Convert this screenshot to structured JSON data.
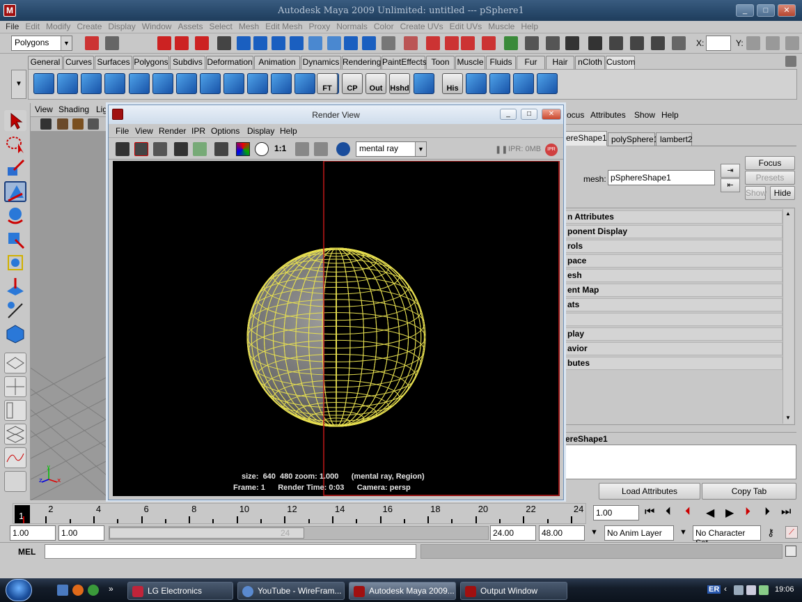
{
  "window": {
    "title": "Autodesk Maya 2009 Unlimited: untitled   ---   pSphere1"
  },
  "menubar": [
    "File",
    "Edit",
    "Modify",
    "Create",
    "Display",
    "Window",
    "Assets",
    "Select",
    "Mesh",
    "Edit Mesh",
    "Proxy",
    "Normals",
    "Color",
    "Create UVs",
    "Edit UVs",
    "Muscle",
    "Help"
  ],
  "statusline": {
    "mode": "Polygons",
    "x_label": "X:",
    "y_label": "Y:"
  },
  "shelf": {
    "tabs": [
      "General",
      "Curves",
      "Surfaces",
      "Polygons",
      "Subdivs",
      "Deformation",
      "Animation",
      "Dynamics",
      "Rendering",
      "PaintEffects",
      "Toon",
      "Muscle",
      "Fluids",
      "Fur",
      "Hair",
      "nCloth",
      "Custom"
    ],
    "active_tab": "Custom",
    "text_icons": [
      "FT",
      "CP",
      "Out",
      "Hshd",
      "His"
    ]
  },
  "viewport": {
    "menu": [
      "View",
      "Shading",
      "Lig"
    ]
  },
  "render_view": {
    "title": "Render View",
    "menu": [
      "File",
      "View",
      "Render",
      "IPR",
      "Options",
      "Display",
      "Help"
    ],
    "ratio": "1:1",
    "renderer": "mental ray",
    "ipr_status": "IPR: 0MB",
    "ipr_badge": "IPR",
    "caption_line1": "size:  640  480 zoom: 1.000      (mental ray, Region)",
    "caption_line2": "Frame: 1      Render Time: 0:03      Camera: persp"
  },
  "attribute_editor": {
    "menu": [
      "ocus",
      "Attributes",
      "Show",
      "Help"
    ],
    "tabs": [
      "ereShape1",
      "polySphere1",
      "lambert2"
    ],
    "mesh_label": "mesh:",
    "mesh_value": "pSphereShape1",
    "buttons": {
      "focus": "Focus",
      "presets": "Presets",
      "show": "Show",
      "hide": "Hide"
    },
    "sections": [
      "n Attributes",
      "ponent Display",
      "rols",
      "pace",
      "esh",
      "ent Map",
      "ats",
      "",
      "play",
      "avior",
      "butes"
    ],
    "notes_label": "ereShape1",
    "load_attributes": "Load Attributes",
    "copy_tab": "Copy Tab"
  },
  "timeslider": {
    "current_frame": "1",
    "numbers": [
      "2",
      "4",
      "6",
      "8",
      "10",
      "12",
      "14",
      "16",
      "18",
      "20",
      "22",
      "24"
    ],
    "current_time_field": "1.00"
  },
  "range": {
    "start": "1.00",
    "playback_start": "1.00",
    "range_end_label": "24",
    "playback_end": "24.00",
    "end": "48.00",
    "anim_layer": "No Anim Layer",
    "character_set": "No Character Set"
  },
  "mel": {
    "label": "MEL"
  },
  "taskbar": {
    "items": [
      "LG Electronics",
      "YouTube - WireFram...",
      "Autodesk Maya 2009...",
      "Output Window"
    ],
    "lang": "ER",
    "clock": "19:06"
  }
}
